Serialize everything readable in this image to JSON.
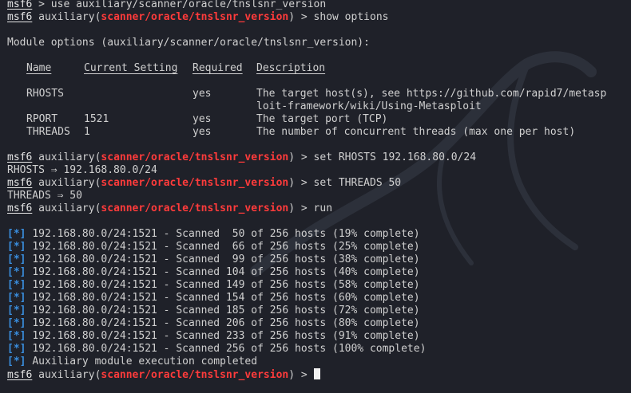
{
  "terminal": {
    "prompt_label": "msf6",
    "module_prefix": "auxiliary(",
    "module_name": "scanner/oracle/tnslsnr_version",
    "module_suffix": ") > ",
    "cmd_use": "use auxiliary/scanner/oracle/tnslsnr_version",
    "cmd_show": "show options",
    "module_options_title": "Module options (auxiliary/scanner/oracle/tnslsnr_version):",
    "options_table": {
      "headers": [
        "Name",
        "Current Setting",
        "Required",
        "Description"
      ],
      "header_underlines": [
        "────",
        "───────────────",
        "────────",
        "───────────"
      ],
      "rows": [
        {
          "name": "RHOSTS",
          "setting": "",
          "required": "yes",
          "description": "The target host(s), see https://github.com/rapid7/metasp",
          "description_cont": "loit-framework/wiki/Using-Metasploit"
        },
        {
          "name": "RPORT",
          "setting": "1521",
          "required": "yes",
          "description": "The target port (TCP)"
        },
        {
          "name": "THREADS",
          "setting": "1",
          "required": "yes",
          "description": "The number of concurrent threads (max one per host)"
        }
      ]
    },
    "cmd_set_rhosts": "set RHOSTS 192.168.80.0/24",
    "rhosts_echo": "RHOSTS ⇒ 192.168.80.0/24",
    "cmd_set_threads": "set THREADS 50",
    "threads_echo": "THREADS ⇒ 50",
    "cmd_run": "run",
    "status_marker": "[*]",
    "scan_lines": [
      "192.168.80.0/24:1521 - Scanned  50 of 256 hosts (19% complete)",
      "192.168.80.0/24:1521 - Scanned  66 of 256 hosts (25% complete)",
      "192.168.80.0/24:1521 - Scanned  99 of 256 hosts (38% complete)",
      "192.168.80.0/24:1521 - Scanned 104 of 256 hosts (40% complete)",
      "192.168.80.0/24:1521 - Scanned 149 of 256 hosts (58% complete)",
      "192.168.80.0/24:1521 - Scanned 154 of 256 hosts (60% complete)",
      "192.168.80.0/24:1521 - Scanned 185 of 256 hosts (72% complete)",
      "192.168.80.0/24:1521 - Scanned 206 of 256 hosts (80% complete)",
      "192.168.80.0/24:1521 - Scanned 233 of 256 hosts (91% complete)",
      "192.168.80.0/24:1521 - Scanned 256 of 256 hosts (100% complete)"
    ],
    "completed_line": "Auxiliary module execution completed"
  },
  "colors": {
    "background": "#1f2129",
    "text": "#d0d0d0",
    "module_red": "#ff3b3b",
    "status_blue": "#3a8fe0"
  }
}
